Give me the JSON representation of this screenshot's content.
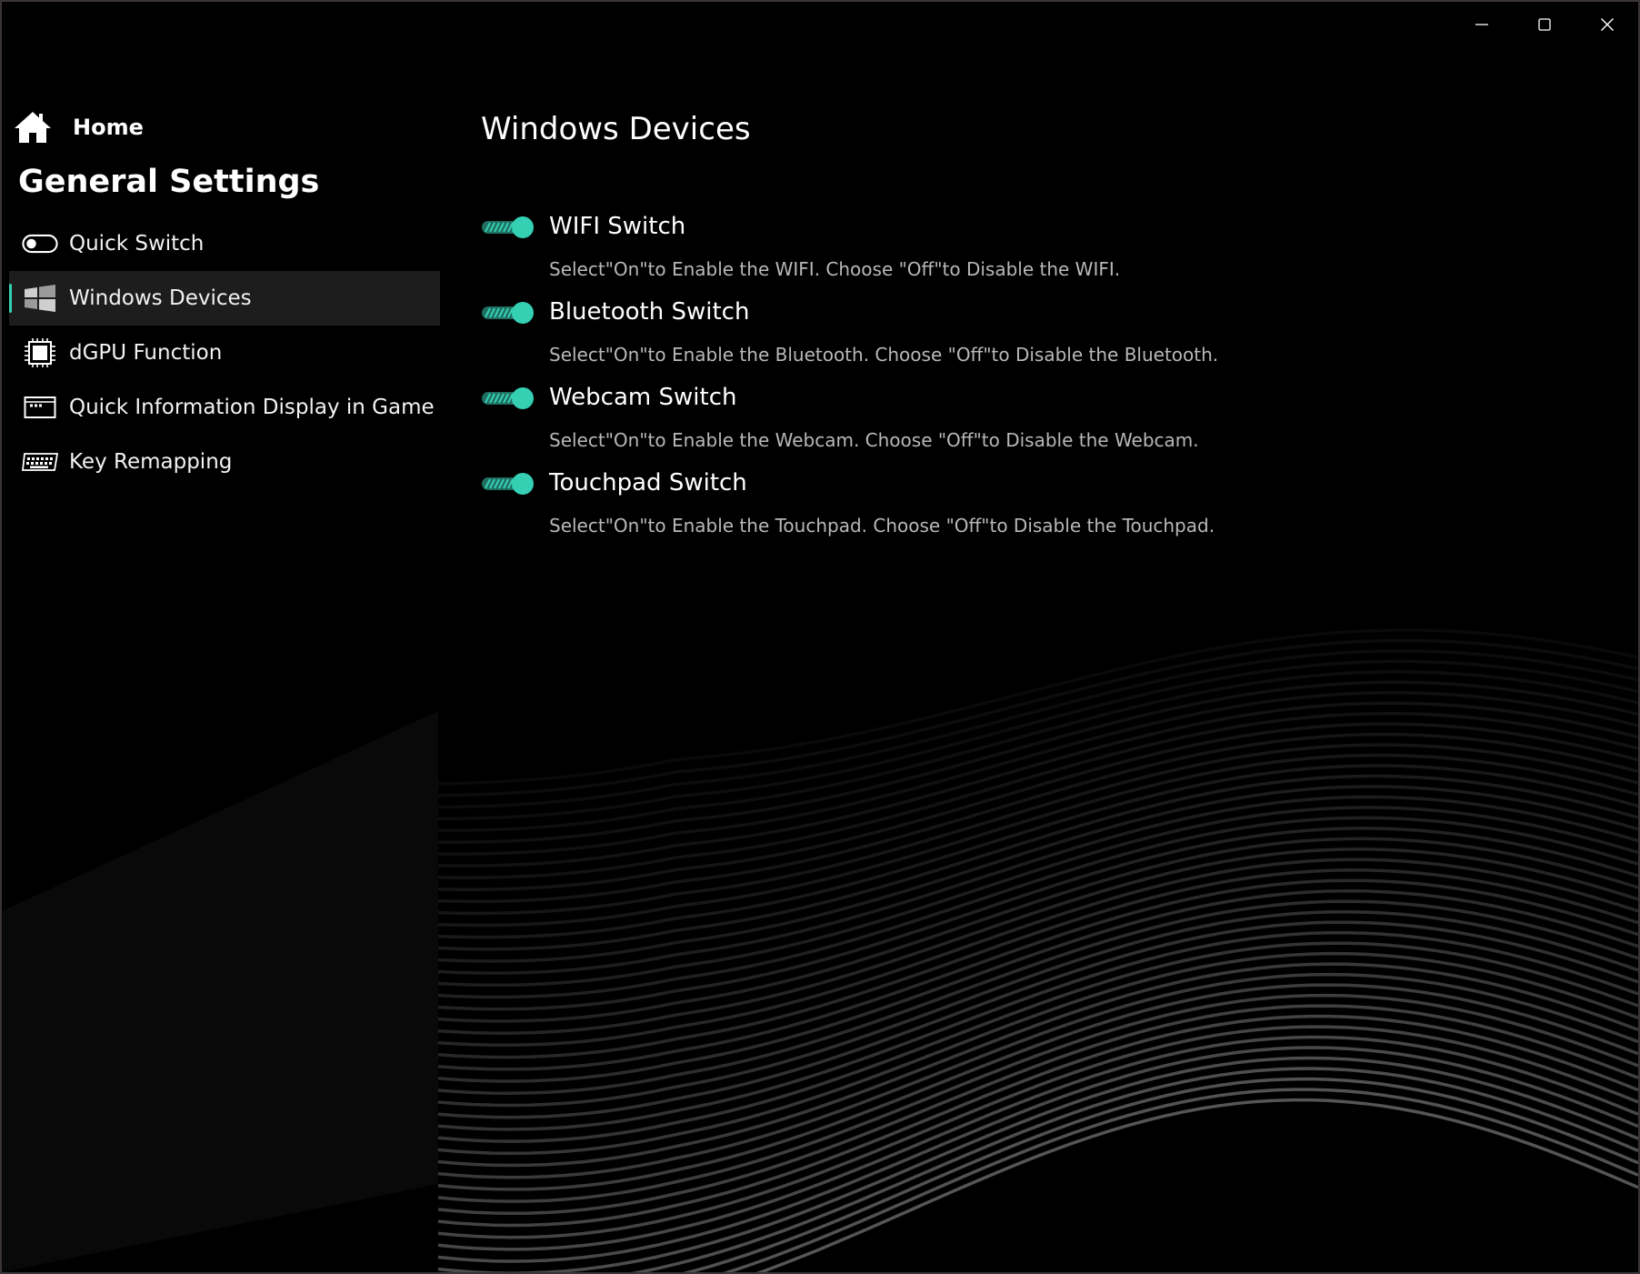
{
  "window": {
    "controls": [
      {
        "name": "minimize",
        "icon": "minimize-icon"
      },
      {
        "name": "maximize",
        "icon": "maximize-icon"
      },
      {
        "name": "close",
        "icon": "close-icon"
      }
    ]
  },
  "sidebar": {
    "home_label": "Home",
    "section_title": "General Settings",
    "items": [
      {
        "label": "Quick Switch",
        "icon": "toggle-switch-icon",
        "active": false
      },
      {
        "label": "Windows Devices",
        "icon": "windows-logo-icon",
        "active": true
      },
      {
        "label": "dGPU Function",
        "icon": "dgpu-chip-icon",
        "active": false
      },
      {
        "label": "Quick Information Display in Game",
        "icon": "display-panel-icon",
        "active": false
      },
      {
        "label": "Key Remapping",
        "icon": "keyboard-icon",
        "active": false
      }
    ]
  },
  "main": {
    "title": "Windows Devices",
    "settings": [
      {
        "title": "WIFI Switch",
        "description": "Select\"On\"to Enable the WIFI. Choose \"Off\"to Disable the WIFI.",
        "state": "on"
      },
      {
        "title": "Bluetooth Switch",
        "description": "Select\"On\"to Enable the Bluetooth. Choose \"Off\"to Disable the Bluetooth.",
        "state": "on"
      },
      {
        "title": "Webcam Switch",
        "description": "Select\"On\"to Enable the Webcam. Choose \"Off\"to Disable the Webcam.",
        "state": "on"
      },
      {
        "title": "Touchpad Switch",
        "description": "Select\"On\"to Enable the Touchpad. Choose \"Off\"to Disable the Touchpad.",
        "state": "on"
      }
    ]
  },
  "colors": {
    "accent": "#35d0b4",
    "background": "#000000",
    "active_item_bg": "#1d1d1d",
    "description_text": "#b8b8b8"
  }
}
